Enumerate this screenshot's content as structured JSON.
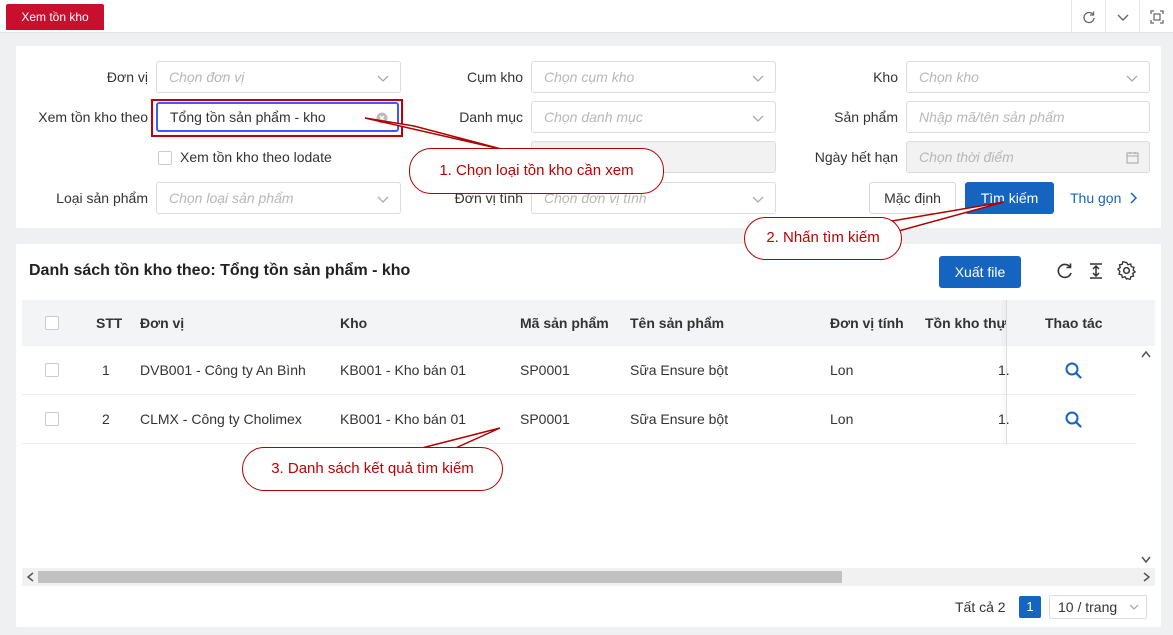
{
  "topbar": {
    "active_tab": "Xem tồn kho"
  },
  "filters": {
    "don_vi": {
      "label": "Đơn vị",
      "placeholder": "Chọn đơn vị"
    },
    "cum_kho": {
      "label": "Cụm kho",
      "placeholder": "Chọn cụm kho"
    },
    "kho": {
      "label": "Kho",
      "placeholder": "Chọn kho"
    },
    "xem_ton_kho_theo": {
      "label": "Xem tồn kho theo",
      "value": "Tổng tồn sản phẩm - kho"
    },
    "danh_muc": {
      "label": "Danh mục",
      "placeholder": "Chọn danh mục"
    },
    "san_pham": {
      "label": "Sản phẩm",
      "placeholder": "Nhập mã/tên sản phẩm"
    },
    "lodate": {
      "label": "Xem tồn kho theo lodate"
    },
    "ngay_het_han": {
      "label": "Ngày hết hạn",
      "placeholder": "Chọn thời điểm"
    },
    "loai_san_pham": {
      "label": "Loại sản phẩm",
      "placeholder": "Chọn loại sản phẩm"
    },
    "don_vi_tinh": {
      "label": "Đơn vị tính",
      "placeholder": "Chọn đơn vị tính"
    },
    "buttons": {
      "default": "Mặc định",
      "search": "Tìm kiếm",
      "collapse": "Thu gọn"
    }
  },
  "list": {
    "title": "Danh sách tồn kho theo: Tổng tồn sản phẩm - kho",
    "export": "Xuất file",
    "columns": [
      "STT",
      "Đơn vị",
      "Kho",
      "Mã sản phẩm",
      "Tên sản phẩm",
      "Đơn vị tính",
      "Tồn kho thự",
      "Thao tác"
    ],
    "rows": [
      {
        "stt": "1",
        "don_vi": "DVB001 - Công ty An Bình",
        "kho": "KB001 - Kho bán 01",
        "ma_sp": "SP0001",
        "ten_sp": "Sữa Ensure bột",
        "dvt": "Lon",
        "ton": "1."
      },
      {
        "stt": "2",
        "don_vi": "CLMX - Công ty Cholimex",
        "kho": "KB001 - Kho bán 01",
        "ma_sp": "SP0001",
        "ten_sp": "Sữa Ensure bột",
        "dvt": "Lon",
        "ton": "1."
      }
    ],
    "pager": {
      "total": "Tất cả 2",
      "page": "1",
      "size": "10 / trang"
    }
  },
  "callouts": {
    "c1": "1. Chọn loại tồn kho cần xem",
    "c2": "2. Nhấn tìm kiếm",
    "c3": "3. Danh sách kết quả tìm kiếm"
  },
  "colors": {
    "brand_red": "#c8102e",
    "primary": "#1565c0",
    "callout": "#c00000"
  }
}
